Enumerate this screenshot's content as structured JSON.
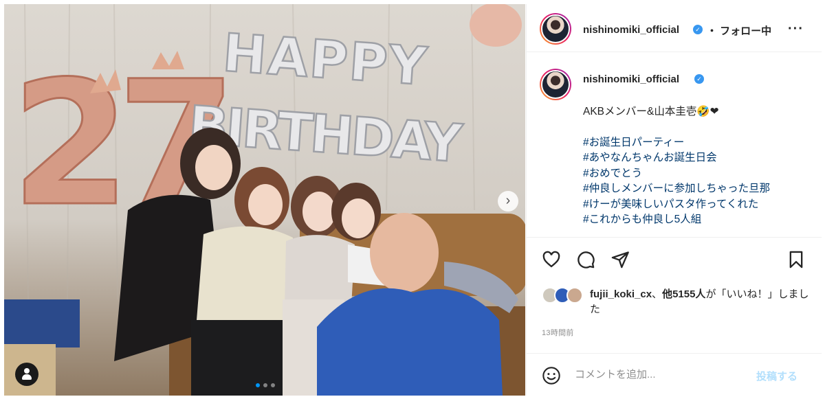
{
  "post": {
    "username": "nishinomiki_official",
    "follow_label": "・ フォロー中",
    "more_icon": "more-horizontal-icon",
    "verified_icon": "verified-badge-icon"
  },
  "photo": {
    "balloon_text_top": "HAPPY",
    "balloon_text_bottom": "BIRTHDAY",
    "balloon_number": "27",
    "carousel_dots": 3,
    "active_dot": 0,
    "next_icon": "chevron-right-icon",
    "tag_icon": "user-tag-icon"
  },
  "caption": {
    "username": "nishinomiki_official",
    "text": "AKBメンバー&山本圭壱🤣❤",
    "hashtags": [
      "#お誕生日パーティー",
      "#あやなんちゃんお誕生日会",
      "#おめでとう",
      "#仲良しメンバーに参加しちゃった旦那",
      "#けーが美味しいパスタ作ってくれた",
      "#これからも仲良し5人組"
    ]
  },
  "actions": {
    "like_icon": "heart-icon",
    "comment_icon": "comment-icon",
    "share_icon": "send-icon",
    "save_icon": "bookmark-icon"
  },
  "likes": {
    "user": "fujii_koki_cx",
    "separator": "、",
    "others": "他5155人",
    "suffix": "が「いいね！」しました"
  },
  "timestamp": "13時間前",
  "comment": {
    "emoji_icon": "emoji-smile-icon",
    "placeholder": "コメントを追加...",
    "post_label": "投稿する"
  },
  "colors": {
    "accent": "#0095f6",
    "hashtag": "#00376b",
    "post_disabled": "#b2dffc"
  }
}
